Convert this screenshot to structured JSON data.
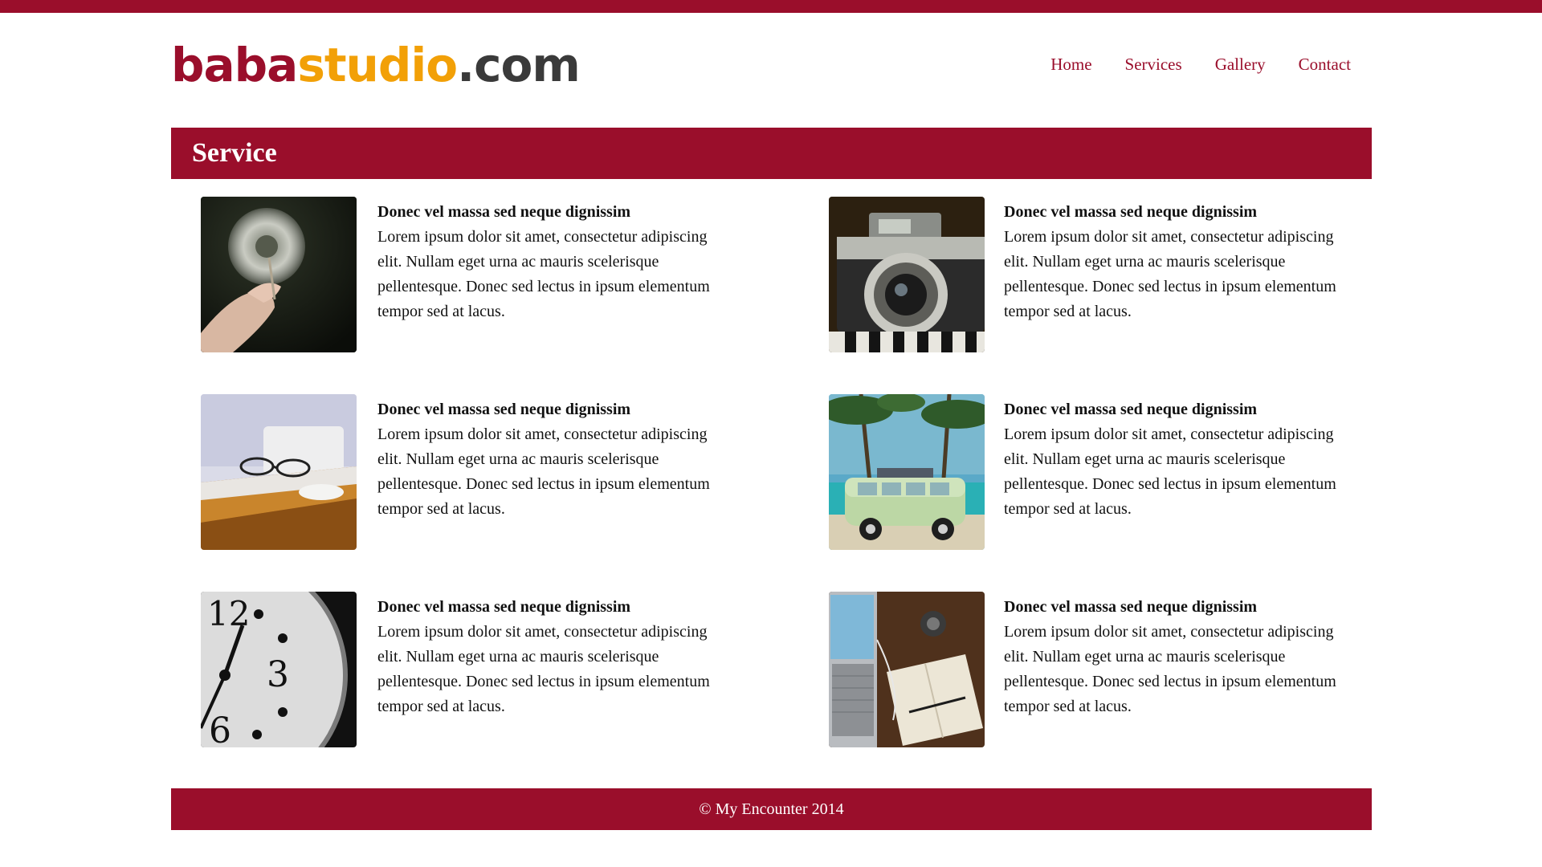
{
  "brand": {
    "logo_part1": "baba",
    "logo_part2": "studio",
    "logo_part3": ".com"
  },
  "nav": {
    "items": [
      {
        "label": "Home"
      },
      {
        "label": "Services"
      },
      {
        "label": "Gallery"
      },
      {
        "label": "Contact"
      }
    ]
  },
  "section": {
    "title": "Service"
  },
  "services": [
    {
      "image": "dandelion-photo",
      "title": "Donec vel massa sed neque dignissim",
      "description": "Lorem ipsum dolor sit amet, consectetur adipiscing elit. Nullam eget urna ac mauris scelerisque pellentesque. Donec sed lectus in ipsum elementum tempor sed at lacus."
    },
    {
      "image": "camera-photo",
      "title": "Donec vel massa sed neque dignissim",
      "description": "Lorem ipsum dolor sit amet, consectetur adipiscing elit. Nullam eget urna ac mauris scelerisque pellentesque. Donec sed lectus in ipsum elementum tempor sed at lacus."
    },
    {
      "image": "desk-glasses-photo",
      "title": "Donec vel massa sed neque dignissim",
      "description": "Lorem ipsum dolor sit amet, consectetur adipiscing elit. Nullam eget urna ac mauris scelerisque pellentesque. Donec sed lectus in ipsum elementum tempor sed at lacus."
    },
    {
      "image": "van-beach-photo",
      "title": "Donec vel massa sed neque dignissim",
      "description": "Lorem ipsum dolor sit amet, consectetur adipiscing elit. Nullam eget urna ac mauris scelerisque pellentesque. Donec sed lectus in ipsum elementum tempor sed at lacus."
    },
    {
      "image": "clock-photo",
      "title": "Donec vel massa sed neque dignissim",
      "description": "Lorem ipsum dolor sit amet, consectetur adipiscing elit. Nullam eget urna ac mauris scelerisque pellentesque. Donec sed lectus in ipsum elementum tempor sed at lacus."
    },
    {
      "image": "laptop-notebook-photo",
      "title": "Donec vel massa sed neque dignissim",
      "description": "Lorem ipsum dolor sit amet, consectetur adipiscing elit. Nullam eget urna ac mauris scelerisque pellentesque. Donec sed lectus in ipsum elementum tempor sed at lacus."
    }
  ],
  "footer": {
    "text": "© My Encounter 2014"
  },
  "colors": {
    "brand": "#9a0e2b",
    "logo_accent": "#f2a007",
    "logo_dark": "#3a3a3a",
    "background": "#ffffff"
  }
}
